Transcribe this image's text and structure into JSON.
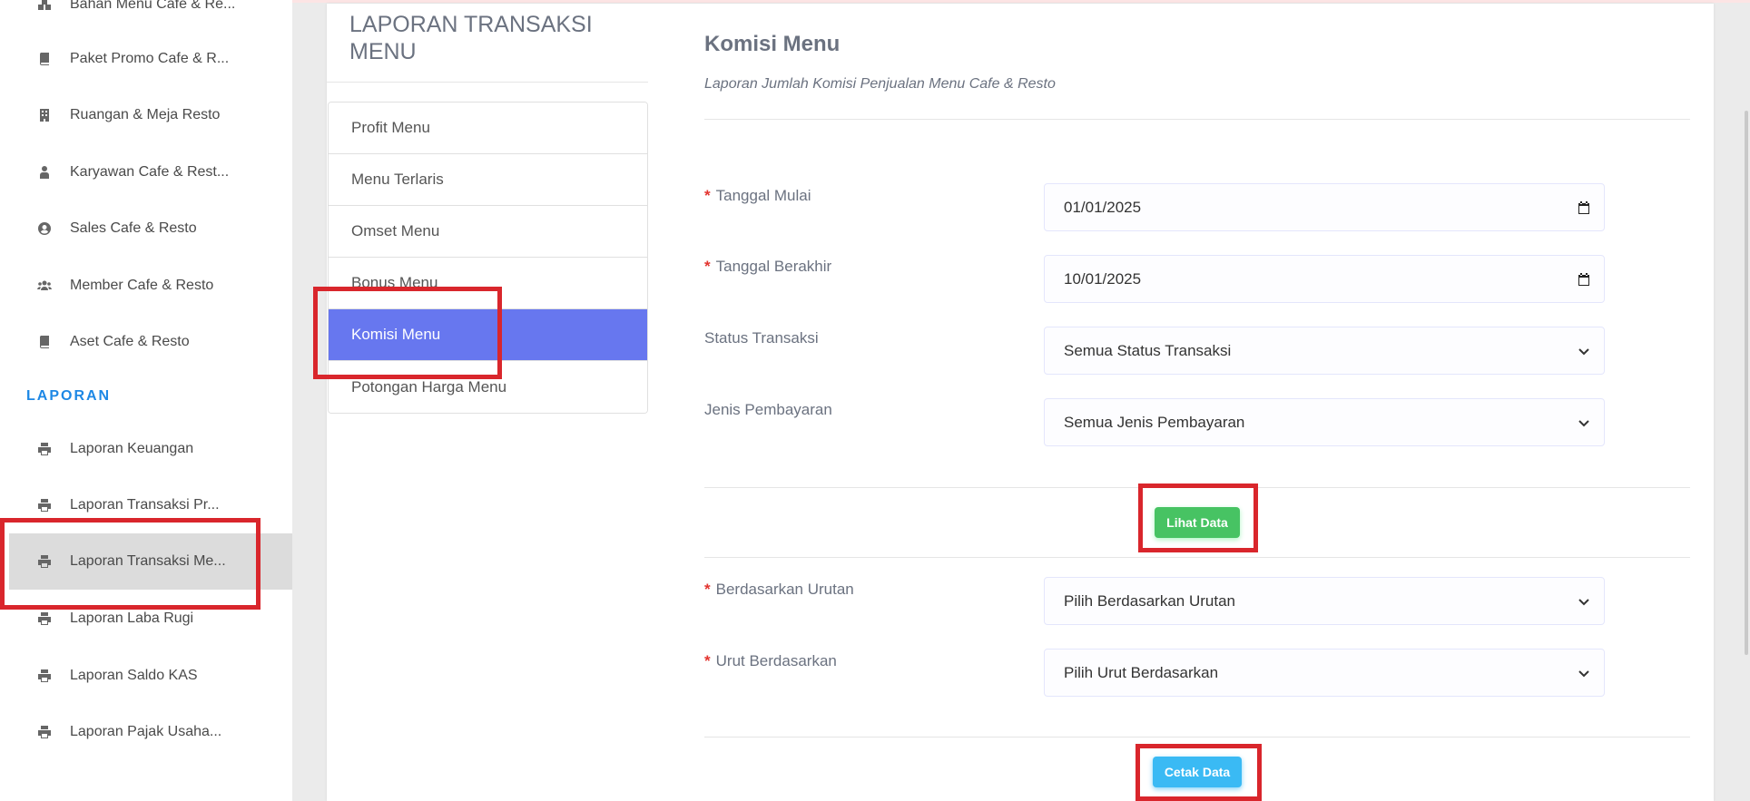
{
  "sidebar": {
    "items": [
      {
        "label": "Bahan Menu Cafe & Re...",
        "icon": "cubes-icon"
      },
      {
        "label": "Paket Promo Cafe & R...",
        "icon": "book-icon"
      },
      {
        "label": "Ruangan & Meja Resto",
        "icon": "building-icon"
      },
      {
        "label": "Karyawan Cafe & Rest...",
        "icon": "user-tie-icon"
      },
      {
        "label": "Sales Cafe & Resto",
        "icon": "user-circle-icon"
      },
      {
        "label": "Member Cafe & Resto",
        "icon": "users-icon"
      },
      {
        "label": "Aset Cafe & Resto",
        "icon": "book-icon"
      }
    ],
    "section": "LAPORAN",
    "report_items": [
      {
        "label": "Laporan Keuangan",
        "icon": "printer-icon"
      },
      {
        "label": "Laporan Transaksi Pr...",
        "icon": "printer-icon"
      },
      {
        "label": "Laporan Transaksi Me...",
        "icon": "printer-icon",
        "active": true
      },
      {
        "label": "Laporan Laba Rugi",
        "icon": "printer-icon"
      },
      {
        "label": "Laporan Saldo KAS",
        "icon": "printer-icon"
      },
      {
        "label": "Laporan Pajak Usaha...",
        "icon": "printer-icon"
      }
    ]
  },
  "report_menu": {
    "title": "LAPORAN TRANSAKSI MENU",
    "items": [
      "Profit Menu",
      "Menu Terlaris",
      "Omset Menu",
      "Bonus Menu",
      "Komisi Menu",
      "Potongan Harga Menu"
    ],
    "active": "Komisi Menu"
  },
  "form": {
    "title": "Komisi Menu",
    "subtitle": "Laporan Jumlah Komisi Penjualan Menu Cafe & Resto",
    "required_mark": "*",
    "tanggal_mulai": {
      "label": "Tanggal Mulai",
      "value": "01/01/2025"
    },
    "tanggal_berakhir": {
      "label": "Tanggal Berakhir",
      "value": "10/01/2025"
    },
    "status_transaksi": {
      "label": "Status Transaksi",
      "value": "Semua Status Transaksi"
    },
    "jenis_pembayaran": {
      "label": "Jenis Pembayaran",
      "value": "Semua Jenis Pembayaran"
    },
    "lihat_button": "Lihat Data",
    "berdasarkan_urutan": {
      "label": "Berdasarkan Urutan",
      "value": "Pilih Berdasarkan Urutan"
    },
    "urut_berdasarkan": {
      "label": "Urut Berdasarkan",
      "value": "Pilih Urut Berdasarkan"
    },
    "cetak_button": "Cetak Data"
  },
  "colors": {
    "accent": "#6777ef",
    "section": "#1e88e5",
    "success": "#47c363",
    "info": "#3abaf4",
    "highlight": "#d9262c"
  }
}
